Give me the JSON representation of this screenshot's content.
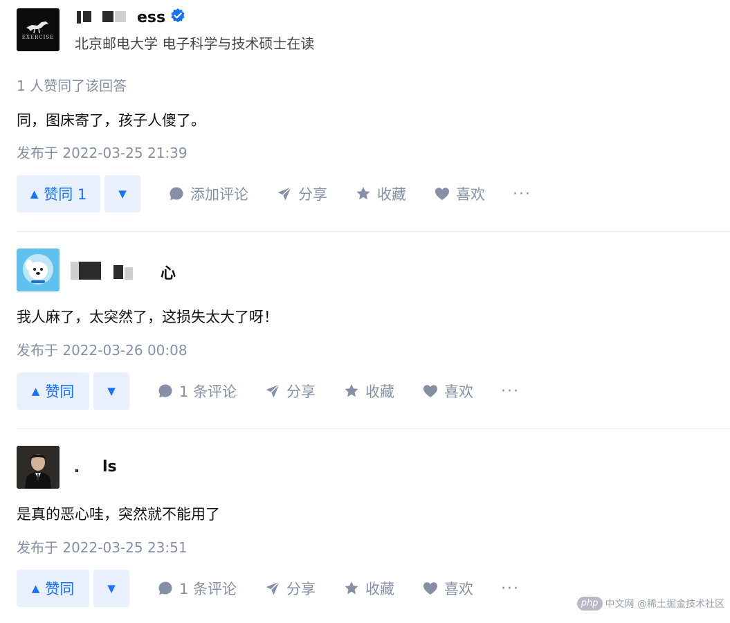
{
  "answers": [
    {
      "author_name": "ess",
      "headline": "北京邮电大学 电子科学与技术硕士在读",
      "avatar_text": "EXERCISE",
      "vote_count_text": "1 人赞同了该回答",
      "content": "同，图床寄了，孩子人傻了。",
      "time": "发布于 2022-03-25 21:39",
      "vote_up_label": "赞同 1",
      "comment_label": "添加评论",
      "share_label": "分享",
      "collect_label": "收藏",
      "like_label": "喜欢",
      "more_label": "···"
    },
    {
      "author_name": "心",
      "content": "我人麻了，太突然了，这损失太大了呀！",
      "time": "发布于 2022-03-26 00:08",
      "vote_up_label": "赞同",
      "comment_label": "1 条评论",
      "share_label": "分享",
      "collect_label": "收藏",
      "like_label": "喜欢",
      "more_label": "···"
    },
    {
      "author_name": "ls",
      "content": "是真的恶心哇，突然就不能用了",
      "time": "发布于 2022-03-25 23:51",
      "vote_up_label": "赞同",
      "comment_label": "1 条评论",
      "share_label": "分享",
      "collect_label": "收藏",
      "like_label": "喜欢",
      "more_label": "···"
    }
  ],
  "watermark": {
    "logo": "php",
    "text": "中文网 @稀土掘金技术社区"
  },
  "colors": {
    "accent": "#1772f6",
    "accent_bg": "#e8f0fe",
    "muted": "#8590a6",
    "verified": "#1772f6"
  },
  "icons": [
    "verified-icon",
    "comment-icon",
    "share-icon",
    "star-icon",
    "heart-icon"
  ]
}
